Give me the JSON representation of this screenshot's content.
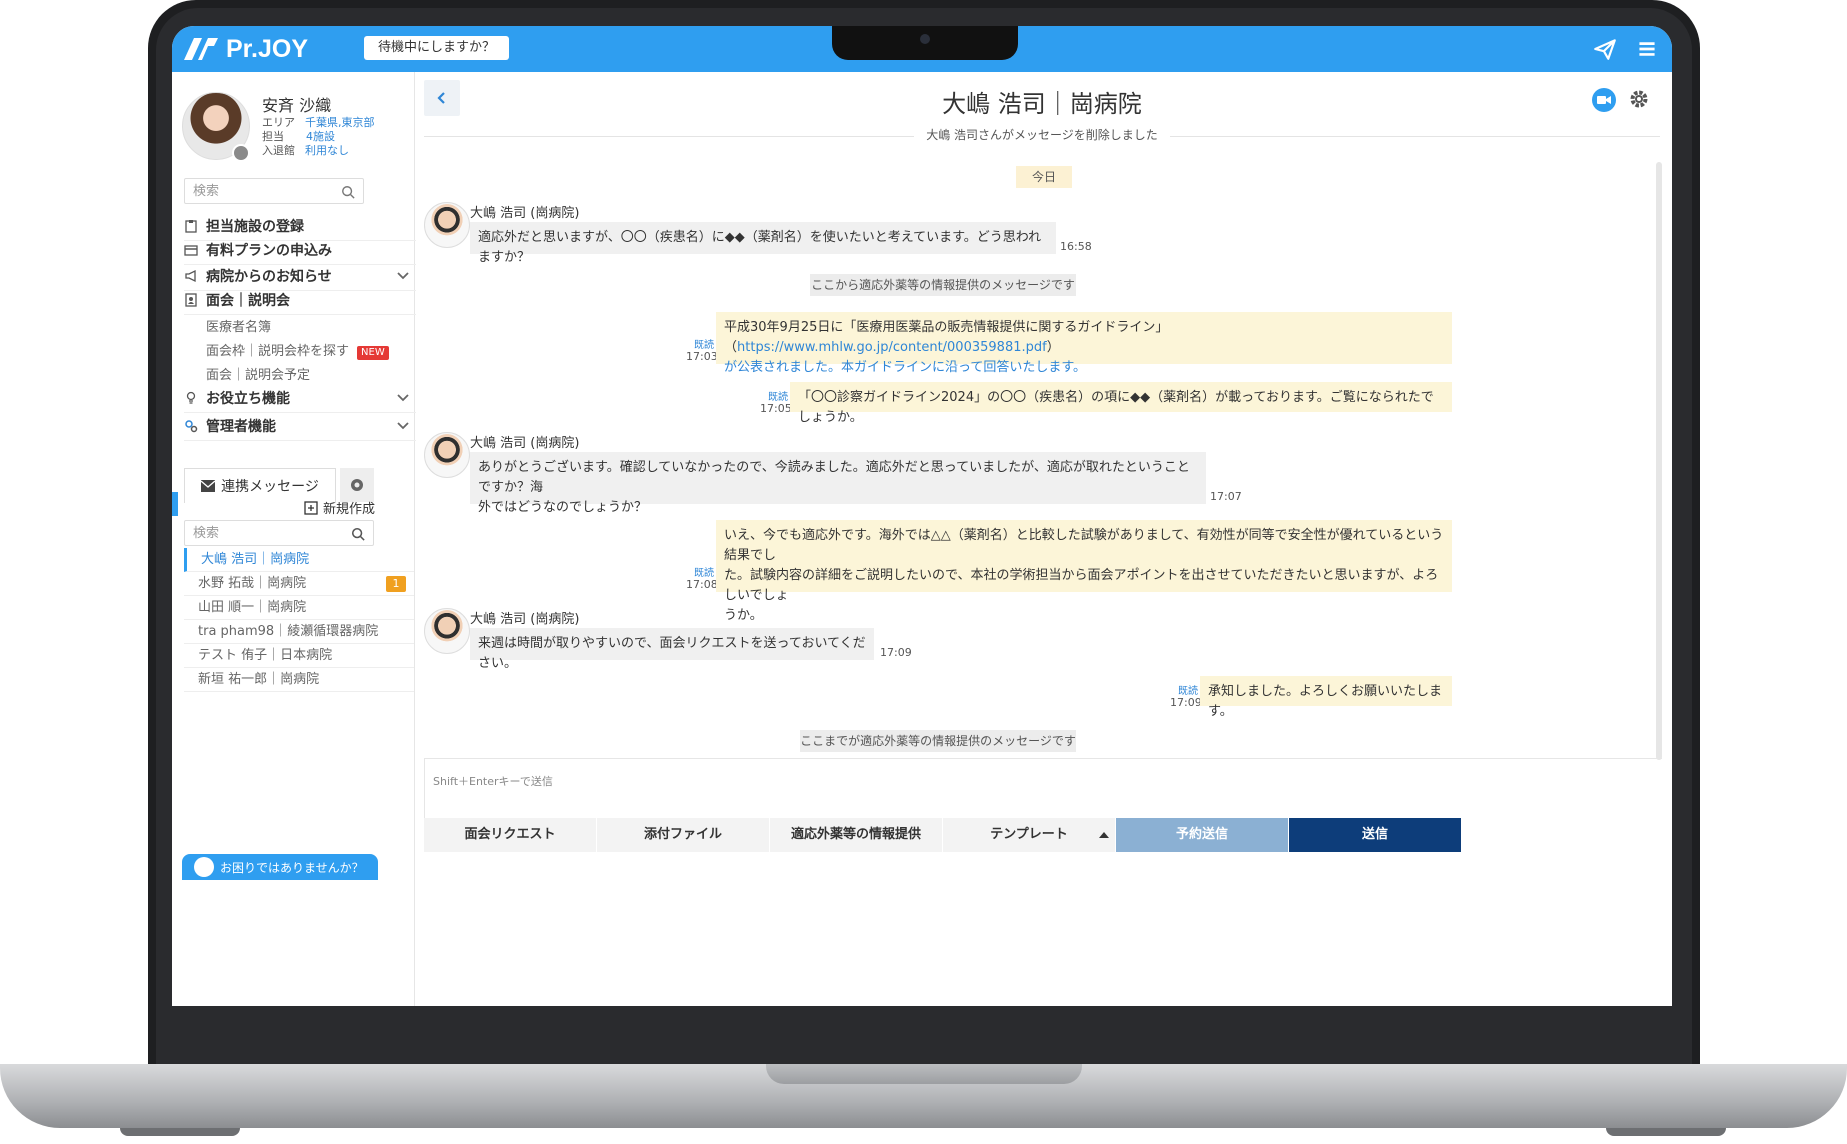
{
  "app": {
    "logo_text": "Pr.JOY",
    "standby_button": "待機中にしますか？"
  },
  "profile": {
    "name": "安斉 沙織",
    "area_label": "エリア",
    "area_value": "千葉県,東京部",
    "charge_label": "担当",
    "charge_value": "4施設",
    "entry_label": "入退館",
    "entry_value": "利用なし"
  },
  "sidebar": {
    "search_placeholder": "検索",
    "menu": [
      {
        "label": "担当施設の登録",
        "icon": "clipboard-icon"
      },
      {
        "label": "有料プランの申込み",
        "icon": "card-icon"
      },
      {
        "label": "病院からのお知らせ",
        "icon": "megaphone-icon"
      },
      {
        "label": "面会｜説明会",
        "icon": "person-card-icon"
      }
    ],
    "submenu": [
      {
        "label": "医療者名簿"
      },
      {
        "label": "面会枠｜説明会枠を探す",
        "badge": "NEW"
      },
      {
        "label": "面会｜説明会予定"
      }
    ],
    "menu2": [
      {
        "label": "お役立ち機能",
        "icon": "bulb-icon"
      },
      {
        "label": "管理者機能",
        "icon": "gears-icon"
      }
    ],
    "message_tab": "連携メッセージ",
    "new_create": "新規作成",
    "conv_search_placeholder": "検索",
    "conversations": [
      {
        "label": "大嶋 浩司｜崗病院",
        "active": true
      },
      {
        "label": "水野 拓哉｜崗病院",
        "unread": "1"
      },
      {
        "label": "山田 順一｜崗病院"
      },
      {
        "label": "tra pham98｜綾瀬循環器病院"
      },
      {
        "label": "テスト 侑子｜日本病院"
      },
      {
        "label": "新垣 祐一郎｜崗病院"
      }
    ],
    "help_text": "お困りではありませんか？"
  },
  "chat": {
    "title": "大嶋 浩司｜崗病院",
    "system_deleted": "大嶋 浩司さんがメッセージを削除しました",
    "today": "今日",
    "divider_start": "ここから適応外薬等の情報提供のメッセージです",
    "divider_end": "ここまでが適応外薬等の情報提供のメッセージです",
    "sender_name": "大嶋 浩司 (崗病院)",
    "read_label": "既読",
    "messages": [
      {
        "text": "適応外だと思いますが、〇〇（疾患名）に◆◆（薬剤名）を使いたいと考えています。どう思われますか？",
        "time": "16:58"
      },
      {
        "text_a": "平成30年9月25日に「医療用医薬品の販売情報提供に関するガイドライン」（",
        "link": "https://www.mhlw.go.jp/content/000359881.pdf",
        "text_b": "）",
        "text_c": "が公表されました。本ガイドラインに沿って回答いたします。",
        "time": "17:03"
      },
      {
        "text": "「〇〇診察ガイドライン2024」の〇〇（疾患名）の項に◆◆（薬剤名）が載っております。ご覧になられたでしょうか。",
        "time": "17:05"
      },
      {
        "text_a": "ありがとうございます。確認していなかったので、今読みました。適応外だと思っていましたが、適応が取れたということですか？海",
        "text_b": "外ではどうなのでしょうか？",
        "time": "17:07"
      },
      {
        "text_a": "いえ、今でも適応外です。海外では△△（薬剤名）と比較した試験がありまして、有効性が同等で安全性が優れているという結果でし",
        "text_b": "た。試験内容の詳細をご説明したいので、本社の学術担当から面会アポイントを出させていただきたいと思いますが、よろしいでしょ",
        "text_c": "うか。",
        "time": "17:08"
      },
      {
        "text": "来週は時間が取りやすいので、面会リクエストを送っておいてください。",
        "time": "17:09"
      },
      {
        "text": "承知しました。よろしくお願いいたします。",
        "time": "17:09"
      }
    ],
    "input_placeholder": "Shift＋Enterキーで送信",
    "toolbar": {
      "request": "面会リクエスト",
      "attach": "添付ファイル",
      "offlabel": "適応外薬等の情報提供",
      "template": "テンプレート",
      "schedule": "予約送信",
      "send": "送信"
    }
  },
  "colors": {
    "brand_blue": "#2f9ef0",
    "send_navy": "#0d3d7a",
    "schedule_blue": "#8bb0d3",
    "outgoing_bubble": "#fcf5d8",
    "incoming_bubble": "#f0f0f0"
  }
}
